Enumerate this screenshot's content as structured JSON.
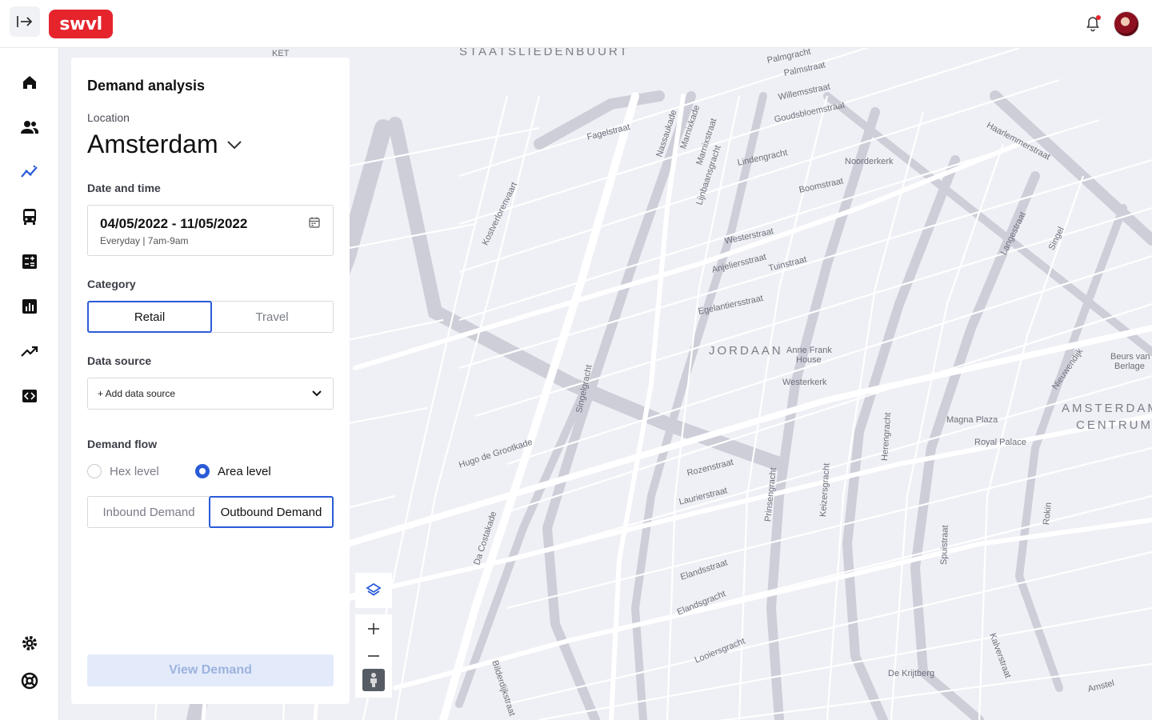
{
  "app": {
    "logo_text": "swvl"
  },
  "nav": {
    "items": [
      {
        "name": "home-icon"
      },
      {
        "name": "users-icon"
      },
      {
        "name": "analytics-icon"
      },
      {
        "name": "bus-icon"
      },
      {
        "name": "calculator-icon"
      },
      {
        "name": "bar-chart-icon"
      },
      {
        "name": "trend-icon"
      },
      {
        "name": "code-icon"
      },
      {
        "name": "settings-icon"
      },
      {
        "name": "support-icon"
      }
    ]
  },
  "panel": {
    "title": "Demand analysis",
    "location_label": "Location",
    "location_value": "Amsterdam",
    "date_label": "Date and time",
    "date_range": "04/05/2022 - 11/05/2022",
    "date_sub": "Everyday | 7am-9am",
    "category_label": "Category",
    "category_options": [
      "Retail",
      "Travel"
    ],
    "category_selected": "Retail",
    "data_source_label": "Data source",
    "data_source_value": "+ Add data source",
    "demand_flow_label": "Demand flow",
    "level_options": [
      "Hex level",
      "Area level"
    ],
    "level_selected": "Area level",
    "direction_options": [
      "Inbound Demand",
      "Outbound Demand"
    ],
    "direction_selected": "Outbound Demand",
    "view_button": "View Demand"
  },
  "map": {
    "districts": [
      "STAATSLIEDENBUURT",
      "JORDAAN",
      "AMSTERDAM",
      "CENTRUM"
    ],
    "labels": [
      "KET",
      "Palmgracht",
      "Palmstraat",
      "Willemsstraat",
      "Goudsbloemstraat",
      "Fagelstraat",
      "Nassaukade",
      "Marnixkade",
      "Marnixstraat",
      "Lijnbaansgracht",
      "Lindengracht",
      "Noorderkerk",
      "Boomstraat",
      "Haarlemmerstraat",
      "Westerstraat",
      "Anjeliersstraat",
      "Tuinstraat",
      "Egelantiersstraat",
      "Anne Frank",
      "House",
      "Westerkerk",
      "Beurs van",
      "Berlage",
      "Magna Plaza",
      "Royal Palace",
      "Rozenstraat",
      "Laurierstraat",
      "Elandsstraat",
      "Elandsgracht",
      "Looiersgracht",
      "De Krijtberg",
      "Hugo de Grootkade",
      "Da Costakade",
      "Bilderdijkstraat",
      "Kostverlorenvaart",
      "Singelgracht",
      "Prinsengracht",
      "Keizersgracht",
      "Herengracht",
      "Spuistraat",
      "Singel",
      "Nieuwendijk",
      "Rokin",
      "Kalverstraat",
      "Amstel",
      "Langestraat"
    ]
  }
}
